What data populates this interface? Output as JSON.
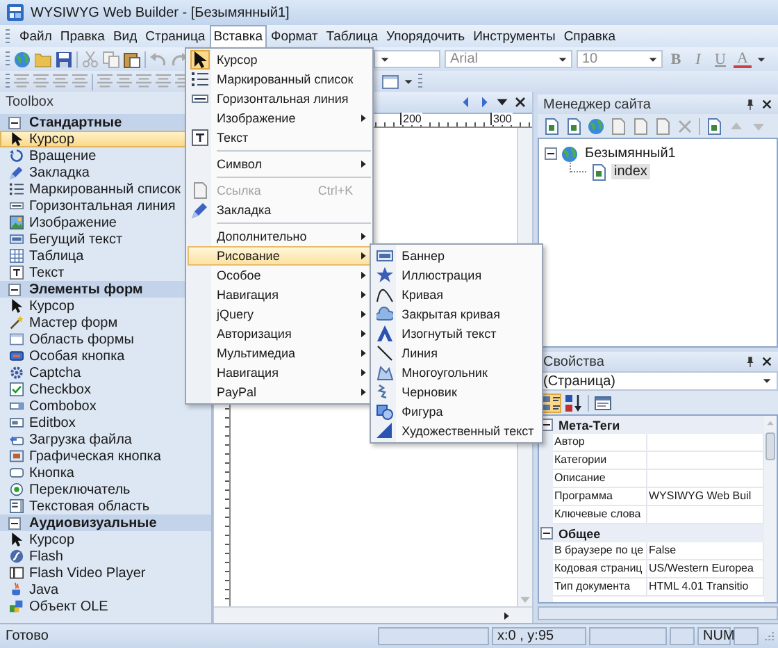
{
  "window": {
    "title": "WYSIWYG Web Builder - [Безымянный1]"
  },
  "menu_bar": [
    {
      "label": "Файл",
      "selected": false
    },
    {
      "label": "Правка",
      "selected": false
    },
    {
      "label": "Вид",
      "selected": false
    },
    {
      "label": "Страница",
      "selected": false
    },
    {
      "label": "Вставка",
      "selected": true
    },
    {
      "label": "Формат",
      "selected": false
    },
    {
      "label": "Таблица",
      "selected": false
    },
    {
      "label": "Упорядочить",
      "selected": false
    },
    {
      "label": "Инструменты",
      "selected": false
    },
    {
      "label": "Справка",
      "selected": false
    }
  ],
  "toolbar": {
    "font": "Arial",
    "size": "10",
    "format_buttons": [
      "B",
      "I",
      "U",
      "A"
    ]
  },
  "toolbox": {
    "title": "Toolbox",
    "groups": [
      {
        "label": "Стандартные",
        "expanded": true,
        "items": [
          {
            "label": "Курсор",
            "selected": true
          },
          {
            "label": "Вращение",
            "selected": false
          },
          {
            "label": "Закладка",
            "selected": false
          },
          {
            "label": "Маркированный список",
            "selected": false
          },
          {
            "label": "Горизонтальная линия",
            "selected": false
          },
          {
            "label": "Изображение",
            "selected": false
          },
          {
            "label": "Бегущий текст",
            "selected": false
          },
          {
            "label": "Таблица",
            "selected": false
          },
          {
            "label": "Текст",
            "selected": false
          }
        ]
      },
      {
        "label": "Элементы форм",
        "expanded": true,
        "items": [
          {
            "label": "Курсор",
            "selected": false
          },
          {
            "label": "Мастер форм",
            "selected": false
          },
          {
            "label": "Область формы",
            "selected": false
          },
          {
            "label": "Особая кнопка",
            "selected": false
          },
          {
            "label": "Captcha",
            "selected": false
          },
          {
            "label": "Checkbox",
            "selected": false
          },
          {
            "label": "Combobox",
            "selected": false
          },
          {
            "label": "Editbox",
            "selected": false
          },
          {
            "label": "Загрузка файла",
            "selected": false
          },
          {
            "label": "Графическая кнопка",
            "selected": false
          },
          {
            "label": "Кнопка",
            "selected": false
          },
          {
            "label": "Переключатель",
            "selected": false
          },
          {
            "label": "Текстовая область",
            "selected": false
          }
        ]
      },
      {
        "label": "Аудиовизуальные",
        "expanded": true,
        "items": [
          {
            "label": "Курсор",
            "selected": false
          },
          {
            "label": "Flash",
            "selected": false
          },
          {
            "label": "Flash Video Player",
            "selected": false
          },
          {
            "label": "Java",
            "selected": false
          },
          {
            "label": "Объект OLE",
            "selected": false
          }
        ]
      }
    ]
  },
  "editor": {
    "ruler_labels": [
      "200",
      "300"
    ]
  },
  "insert_menu": {
    "sections": [
      [
        {
          "label": "Курсор",
          "checked": true,
          "selected": false,
          "disabled": false,
          "submenu": false
        },
        {
          "label": "Маркированный список",
          "checked": false,
          "selected": false,
          "disabled": false,
          "submenu": false
        },
        {
          "label": "Горизонтальная линия",
          "checked": false,
          "selected": false,
          "disabled": false,
          "submenu": false
        },
        {
          "label": "Изображение",
          "checked": false,
          "selected": false,
          "disabled": false,
          "submenu": true
        },
        {
          "label": "Текст",
          "checked": false,
          "selected": false,
          "disabled": false,
          "submenu": false
        }
      ],
      [
        {
          "label": "Символ",
          "checked": false,
          "selected": false,
          "disabled": false,
          "submenu": true
        }
      ],
      [
        {
          "label": "Ссылка",
          "checked": false,
          "selected": false,
          "disabled": true,
          "submenu": false,
          "shortcut": "Ctrl+K"
        },
        {
          "label": "Закладка",
          "checked": false,
          "selected": false,
          "disabled": false,
          "submenu": false
        }
      ],
      [
        {
          "label": "Дополнительно",
          "checked": false,
          "selected": false,
          "disabled": false,
          "submenu": true
        },
        {
          "label": "Рисование",
          "checked": false,
          "selected": true,
          "disabled": false,
          "submenu": true
        },
        {
          "label": "Особое",
          "checked": false,
          "selected": false,
          "disabled": false,
          "submenu": true
        },
        {
          "label": "Навигация",
          "checked": false,
          "selected": false,
          "disabled": false,
          "submenu": true
        },
        {
          "label": "jQuery",
          "checked": false,
          "selected": false,
          "disabled": false,
          "submenu": true
        },
        {
          "label": "Авторизация",
          "checked": false,
          "selected": false,
          "disabled": false,
          "submenu": true
        },
        {
          "label": "Мультимедиа",
          "checked": false,
          "selected": false,
          "disabled": false,
          "submenu": true
        },
        {
          "label": "Навигация",
          "checked": false,
          "selected": false,
          "disabled": false,
          "submenu": true
        },
        {
          "label": "PayPal",
          "checked": false,
          "selected": false,
          "disabled": false,
          "submenu": true
        }
      ]
    ]
  },
  "drawing_submenu": [
    {
      "label": "Баннер"
    },
    {
      "label": "Иллюстрация"
    },
    {
      "label": "Кривая"
    },
    {
      "label": "Закрытая кривая"
    },
    {
      "label": "Изогнутый текст"
    },
    {
      "label": "Линия"
    },
    {
      "label": "Многоугольник"
    },
    {
      "label": "Черновик"
    },
    {
      "label": "Фигура"
    },
    {
      "label": "Художественный текст"
    }
  ],
  "site_manager": {
    "title": "Менеджер сайта",
    "tree": [
      {
        "label": "Безымянный1",
        "expanded": true,
        "selected": false,
        "children": [
          {
            "label": "index",
            "selected": true
          }
        ]
      }
    ]
  },
  "properties": {
    "title": "Свойства",
    "object": "(Страница)",
    "sections": [
      {
        "label": "Мета-Теги",
        "expanded": true,
        "rows": [
          {
            "name": "Автор"
          },
          {
            "name": "Категории"
          },
          {
            "name": "Описание"
          },
          {
            "name": "Программа",
            "value": "WYSIWYG Web Buil"
          },
          {
            "name": "Ключевые слова"
          }
        ]
      },
      {
        "label": "Общее",
        "expanded": true,
        "rows": [
          {
            "name": "В браузере по це",
            "value": "False"
          },
          {
            "name": "Кодовая страниц",
            "value": "US/Western Europea"
          },
          {
            "name": "Тип документа",
            "value": "HTML 4.01 Transitio"
          }
        ]
      }
    ]
  },
  "status_bar": {
    "message": "Готово",
    "coordinates": "x:0 , y:95",
    "num_lock": "NUM"
  }
}
